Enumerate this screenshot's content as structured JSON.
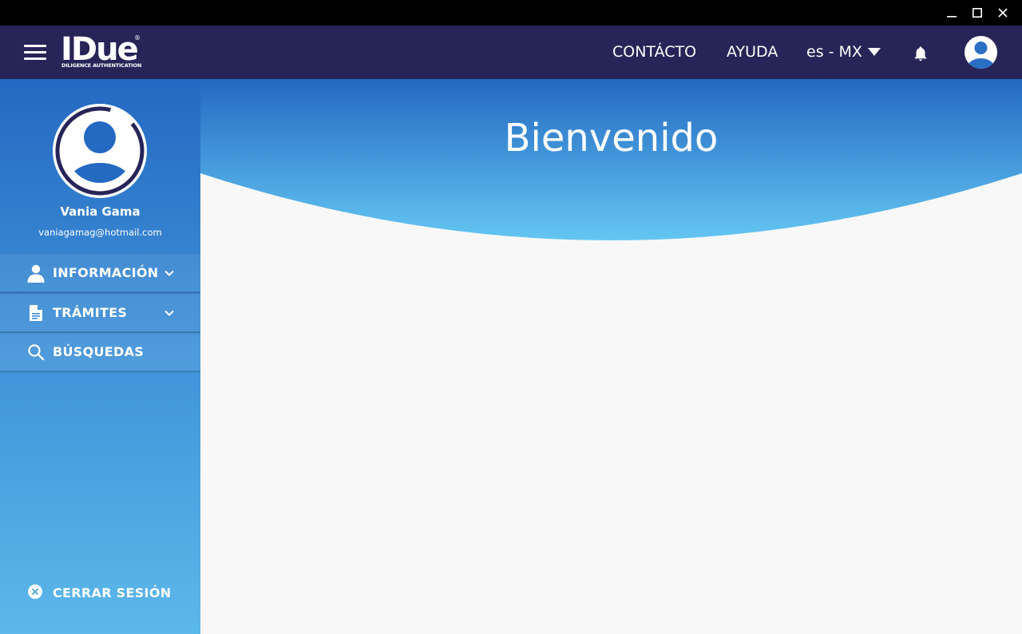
{
  "window": {
    "controls": [
      "minimize-icon",
      "maximize-icon",
      "close-icon"
    ]
  },
  "header": {
    "logo_text": "IDue",
    "logo_registered": "®",
    "logo_subtitle": "DILIGENCE AUTHENTICATION",
    "contact_label": "CONTÁCTO",
    "help_label": "AYUDA",
    "language_label": "es - MX",
    "icons": [
      "menu-icon",
      "bell-icon",
      "user-avatar-icon",
      "caret-down-icon"
    ]
  },
  "sidebar": {
    "user_name": "Vania Gama",
    "user_email": "vaniagamag@hotmail.com",
    "items": [
      {
        "label": "INFORMACIÓN",
        "icon": "user-icon",
        "expandable": true
      },
      {
        "label": "TRÁMITES",
        "icon": "document-icon",
        "expandable": true
      },
      {
        "label": "BÚSQUEDAS",
        "icon": "search-icon",
        "expandable": false
      }
    ],
    "logout_label": "CERRAR SESIÓN"
  },
  "main": {
    "title": "Bienvenido"
  },
  "colors": {
    "header_bg": "#272458",
    "sidebar_top": "#2469c2",
    "sidebar_bottom": "#5bb8ea",
    "banner_top": "#2469c2",
    "banner_bottom": "#64c6f2",
    "content_bg": "#f8f8f8"
  }
}
